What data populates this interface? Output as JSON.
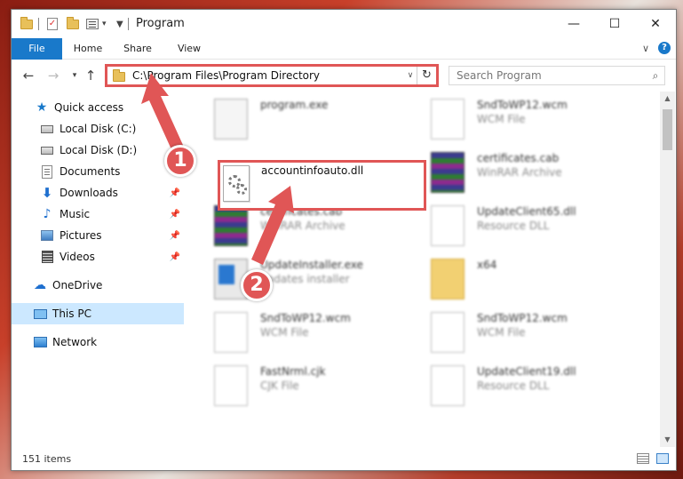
{
  "window": {
    "title": "Program",
    "minimize_glyph": "—",
    "maximize_glyph": "☐",
    "close_glyph": "✕"
  },
  "ribbon": {
    "tabs": [
      "File",
      "Home",
      "Share",
      "View"
    ],
    "expand_glyph": "∨",
    "help_glyph": "?"
  },
  "address": {
    "path": "C:\\Program Files\\Program Directory",
    "search_placeholder": "Search Program"
  },
  "nav_pane": {
    "items": [
      {
        "label": "Quick access",
        "icon": "star-icon",
        "pinned": false
      },
      {
        "label": "Local Disk (C:)",
        "icon": "drive-icon",
        "pinned": false
      },
      {
        "label": "Local Disk (D:)",
        "icon": "drive-icon",
        "pinned": false
      },
      {
        "label": "Documents",
        "icon": "documents-icon",
        "pinned": false
      },
      {
        "label": "Downloads",
        "icon": "download-icon",
        "pinned": true
      },
      {
        "label": "Music",
        "icon": "music-icon",
        "pinned": true
      },
      {
        "label": "Pictures",
        "icon": "pictures-icon",
        "pinned": true
      },
      {
        "label": "Videos",
        "icon": "videos-icon",
        "pinned": true
      },
      {
        "label": "OneDrive",
        "icon": "cloud-icon",
        "pinned": false
      },
      {
        "label": "This PC",
        "icon": "computer-icon",
        "pinned": false,
        "selected": true
      },
      {
        "label": "Network",
        "icon": "network-icon",
        "pinned": false
      }
    ]
  },
  "files": [
    {
      "name": "program.exe",
      "type": "",
      "icon": "setup-icon"
    },
    {
      "name": "SndToWP12.wcm",
      "type": "WCM File",
      "icon": "page-icon"
    },
    {
      "name": "accountinfoauto.dll",
      "type": "",
      "icon": "dll-icon",
      "highlighted": true
    },
    {
      "name": "certificates.cab",
      "type": "WinRAR Archive",
      "icon": "rar-icon"
    },
    {
      "name": "certificates.cab",
      "type": "WinRAR Archive",
      "icon": "rar-icon"
    },
    {
      "name": "UpdateClient65.dll",
      "type": "Resource DLL",
      "icon": "page-icon"
    },
    {
      "name": "UpdateInstaller.exe",
      "type": "updates installer",
      "icon": "exe-icon"
    },
    {
      "name": "x64",
      "type": "",
      "icon": "zip-icon"
    },
    {
      "name": "SndToWP12.wcm",
      "type": "WCM File",
      "icon": "page-icon"
    },
    {
      "name": "SndToWP12.wcm",
      "type": "WCM File",
      "icon": "page-icon"
    },
    {
      "name": "FastNrml.cjk",
      "type": "CJK File",
      "icon": "page-icon"
    },
    {
      "name": "UpdateClient19.dll",
      "type": "Resource DLL",
      "icon": "page-icon"
    }
  ],
  "status": {
    "item_count": "151 items"
  },
  "callouts": {
    "first": "1",
    "second": "2",
    "accent": "#e05656"
  }
}
